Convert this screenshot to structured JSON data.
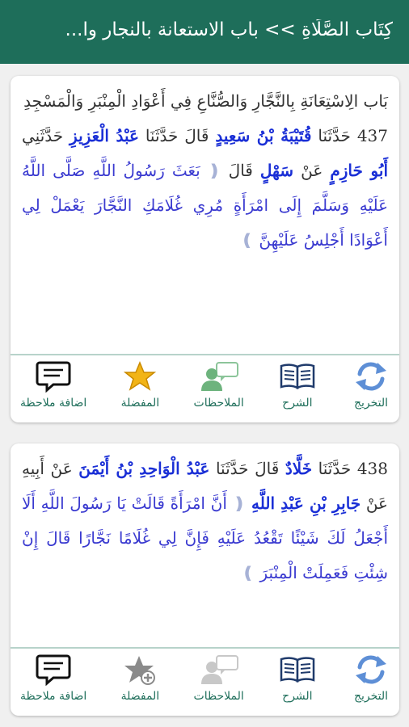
{
  "header": {
    "title": "كِتَاب الصَّلَاةِ >> باب الاستعانة بالنجار وا..."
  },
  "actions": {
    "takhrij": "التخريج",
    "sharh": "الشرح",
    "notes": "الملاحظات",
    "favorite": "المفضلة",
    "add_note": "اضافة ملاحظة"
  },
  "hadith1": {
    "bab": "بَاب الِاسْتِعَانَةِ بِالنَّجَّارِ وَالصُّنَّاعِ فِي أَعْوَادِ الْمِنْبَرِ وَالْمَسْجِدِ",
    "number": "437",
    "t1": "حَدَّثَنَا",
    "n1": "قُتَيْبَةُ بْنُ سَعِيدٍ",
    "t2": "قَالَ حَدَّثَنَا",
    "n2": "عَبْدُ الْعَزِيزِ",
    "t3": "حَدَّثَنِي",
    "n3": "أَبُو حَازِمٍ",
    "t4": "عَنْ",
    "n4": "سَهْلٍ",
    "t5": "قَالَ",
    "open_br": "❪",
    "matn": "بَعَثَ رَسُولُ اللَّهِ صَلَّى اللَّهُ عَلَيْهِ وَسَلَّمَ إِلَى امْرَأَةٍ مُرِي غُلَامَكِ النَّجَّارَ يَعْمَلْ لِي أَعْوَادًا أَجْلِسُ عَلَيْهِنَّ",
    "close_br": "❫"
  },
  "hadith2": {
    "number": "438",
    "t1": "حَدَّثَنَا",
    "n1": "خَلَّادٌ",
    "t2": "قَالَ حَدَّثَنَا",
    "n2": "عَبْدُ الْوَاحِدِ بْنُ أَيْمَنَ",
    "t3": "عَنْ أَبِيهِ عَنْ",
    "n3": "جَابِرِ بْنِ عَبْدِ اللَّهِ",
    "open_br": "❪",
    "matn": "أَنَّ امْرَأَةً قَالَتْ يَا رَسُولَ اللَّهِ أَلَا أَجْعَلُ لَكَ شَيْئًا تَقْعُدُ عَلَيْهِ فَإِنَّ لِي غُلَامًا نَجَّارًا قَالَ إِنْ شِئْتِ فَعَمِلَتْ الْمِنْبَرَ",
    "close_br": "❫"
  },
  "colors": {
    "header": "#1e6e5a",
    "name": "#1a2fd6",
    "matn": "#3a3ad0",
    "label": "#1e6e5a"
  },
  "icons": [
    "refresh-icon",
    "open-book-icon",
    "user-chat-icon",
    "star-icon",
    "star-plus-icon",
    "speech-bubble-icon"
  ]
}
